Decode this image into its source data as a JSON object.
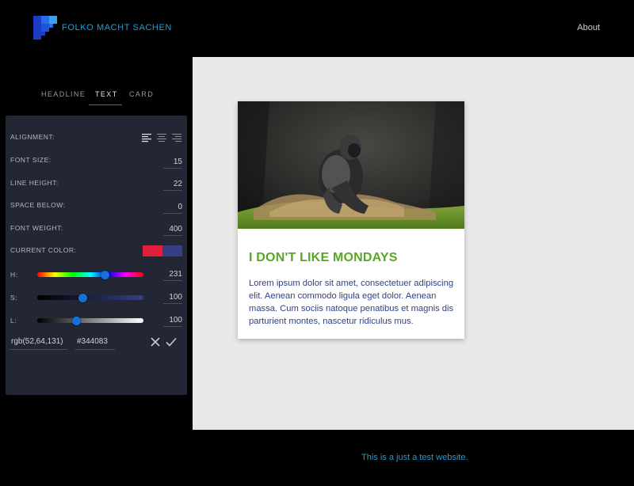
{
  "header": {
    "brand": "FOLKO MACHT SACHEN",
    "about_label": "About",
    "logo_colors": [
      "#1c3cc4",
      "#2a6ce8",
      "#37a3f0"
    ]
  },
  "tabs": [
    {
      "label": "HEADLINE",
      "active": false
    },
    {
      "label": "TEXT",
      "active": true
    },
    {
      "label": "CARD",
      "active": false
    }
  ],
  "panel": {
    "alignment_label": "ALIGNMENT:",
    "alignment_options": [
      "align-left-icon",
      "align-center-icon",
      "align-right-icon"
    ],
    "alignment_selected": "left",
    "font_size_label": "FONT SIZE:",
    "font_size": "15",
    "line_height_label": "LINE HEIGHT:",
    "line_height": "22",
    "space_below_label": "SPACE BELOW:",
    "space_below": "0",
    "font_weight_label": "FONT WEIGHT:",
    "font_weight": "400",
    "current_color_label": "CURRENT COLOR:",
    "previous_color": "#e3203c",
    "current_color": "#344083",
    "h_label": "H:",
    "h_value": "231",
    "h_fraction": 0.64,
    "s_label": "S:",
    "s_value": "100",
    "s_fraction": 0.43,
    "l_label": "L:",
    "l_value": "100",
    "l_fraction": 0.37,
    "rgb_value": "rgb(52,64,131)",
    "hex_value": "#344083"
  },
  "card": {
    "headline": "I DON'T LIKE MONDAYS",
    "headline_color": "#5aa428",
    "body": "Lorem ipsum dolor sit amet, consectetuer adipiscing elit. Aenean commodo ligula eget dolor. Aenean massa. Cum sociis natoque penatibus et magnis dis parturient montes, nascetur ridiculus mus.",
    "body_color": "#344083"
  },
  "footer": {
    "text": "This is a just a test website."
  }
}
